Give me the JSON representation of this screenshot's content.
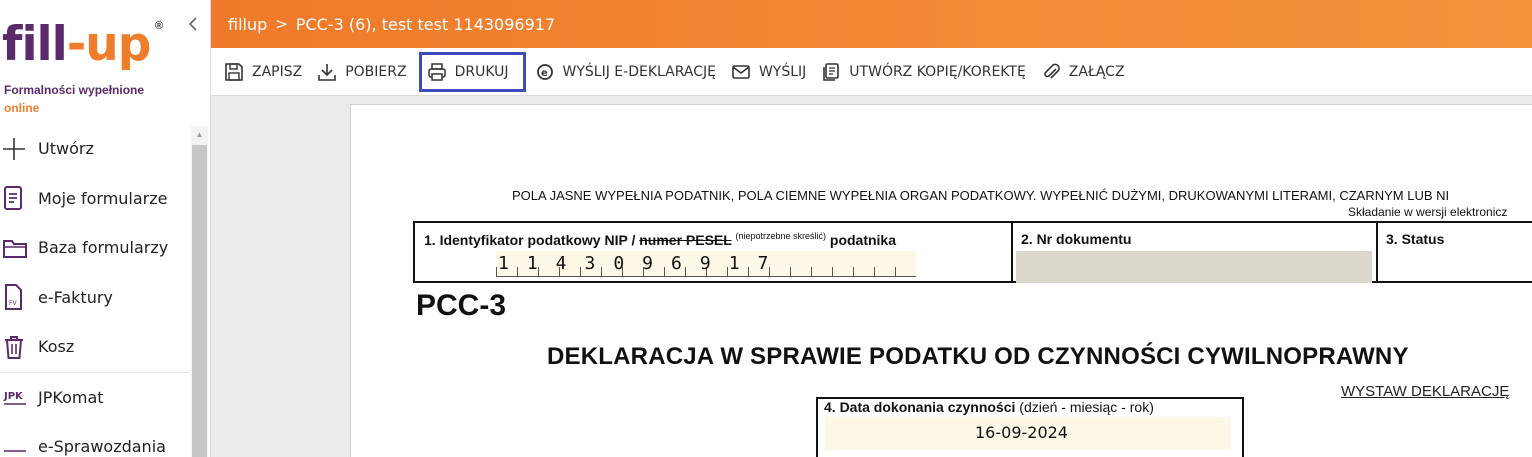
{
  "brand": {
    "logo_fill": "fill",
    "logo_dash": "-",
    "logo_up": "up",
    "registered": "®",
    "tagline_line1": "Formalności wypełnione",
    "tagline_line2": "online",
    "primary_color": "#5a2a6b",
    "accent_color": "#f07d2c"
  },
  "sidebar": {
    "collapse_icon": "chevron-left-icon",
    "items": [
      {
        "label": "Utwórz",
        "icon": "plus-icon"
      },
      {
        "label": "Moje formularze",
        "icon": "document-list-icon"
      },
      {
        "label": "Baza formularzy",
        "icon": "folder-icon"
      },
      {
        "label": "e-Faktury",
        "icon": "invoice-icon"
      },
      {
        "label": "Kosz",
        "icon": "trash-icon"
      },
      {
        "label": "JPKomat",
        "icon": "jpk-icon"
      },
      {
        "label": "e-Sprawozdania",
        "icon": "report-icon"
      }
    ]
  },
  "header": {
    "crumb_root": "fillup",
    "crumb_separator": ">",
    "crumb_current": "PCC-3 (6), test test 1143096917"
  },
  "toolbar": {
    "save": "ZAPISZ",
    "download": "POBIERZ",
    "print": "DRUKUJ",
    "send_edeclaration": "WYŚLIJ E-DEKLARACJĘ",
    "send": "WYŚLIJ",
    "copy_correction": "UTWÓRZ KOPIĘ/KOREKTĘ",
    "attach": "ZAŁĄCZ",
    "active_button": "print",
    "active_border_color": "#3d4bb8"
  },
  "document": {
    "notice": "POLA JASNE WYPEŁNIA PODATNIK, POLA CIEMNE WYPEŁNIA ORGAN PODATKOWY. WYPEŁNIĆ DUŻYMI, DRUKOWANYMI LITERAMI, CZARNYM LUB NI",
    "notice_right": "Składanie w wersji elektronicz",
    "field1_prefix": "1. Identyfikator podatkowy NIP / ",
    "field1_strike": "numer PESEL",
    "field1_sup": "(niepotrzebne skreślić)",
    "field1_suffix": "podatnika",
    "nip_value": "1143096917",
    "field2_label": "2. Nr dokumentu",
    "field3_label": "3. Status",
    "form_code": "PCC-3",
    "title": "DEKLARACJA W SPRAWIE PODATKU OD CZYNNOŚCI CYWILNOPRAWNY",
    "issue_link": "WYSTAW DEKLARACJĘ",
    "field4_label": "4. Data dokonania czynności",
    "field4_hint": "(dzień - miesiąc - rok)",
    "field4_value": "16-09-2024"
  }
}
